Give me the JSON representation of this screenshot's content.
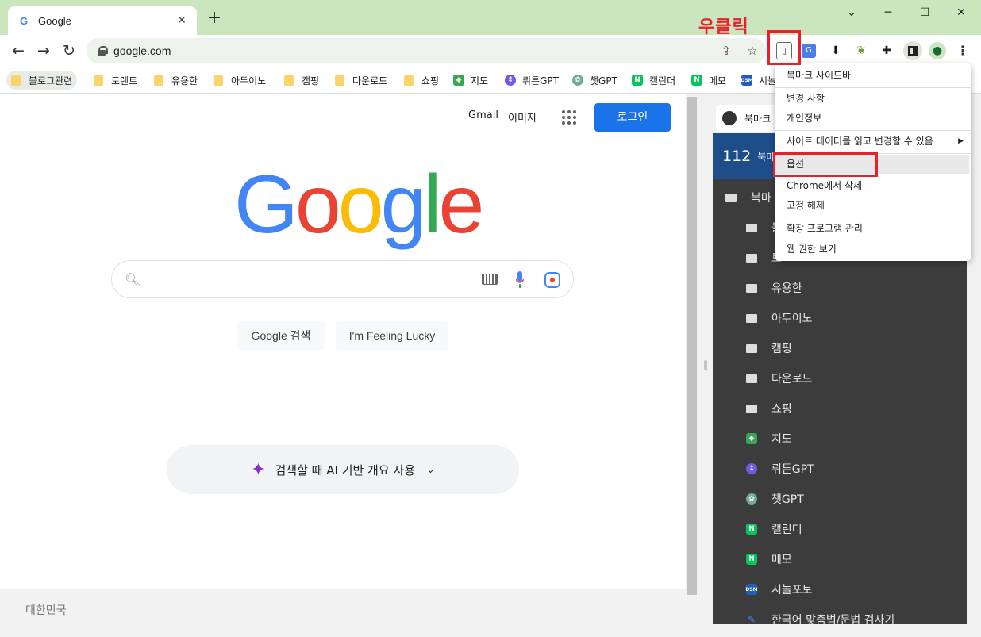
{
  "browser": {
    "tab_title": "Google",
    "tab_favicon": "G",
    "url": "google.com"
  },
  "bookmarks": [
    {
      "label": "블로그관련",
      "icon": "folder"
    },
    {
      "label": "토렌트",
      "icon": "folder"
    },
    {
      "label": "유용한",
      "icon": "folder"
    },
    {
      "label": "아두이노",
      "icon": "folder"
    },
    {
      "label": "캠핑",
      "icon": "folder"
    },
    {
      "label": "다운로드",
      "icon": "folder"
    },
    {
      "label": "쇼핑",
      "icon": "folder"
    },
    {
      "label": "지도",
      "icon": "maps-icon"
    },
    {
      "label": "뤼튼GPT",
      "icon": "wrtn-icon"
    },
    {
      "label": "챗GPT",
      "icon": "chatgpt-icon"
    },
    {
      "label": "캘린더",
      "icon": "naver-icon"
    },
    {
      "label": "메모",
      "icon": "naver-icon"
    },
    {
      "label": "시놀",
      "icon": "dsm-icon"
    }
  ],
  "google": {
    "gmail": "Gmail",
    "images": "이미지",
    "login": "로그인",
    "logo_letters": [
      "G",
      "o",
      "o",
      "g",
      "l",
      "e"
    ],
    "search_button": "Google 검색",
    "lucky_button": "I'm Feeling Lucky",
    "ai_overview": "검색할 때 AI 기반 개요 사용",
    "footer_country": "대한민국"
  },
  "side_panel": {
    "header": "북마크",
    "count": "112",
    "count_label": "북마",
    "root_folder": "북마",
    "items": [
      {
        "label": "블",
        "type": "folder"
      },
      {
        "label": "토",
        "type": "folder"
      },
      {
        "label": "유용한",
        "type": "folder"
      },
      {
        "label": "아두이노",
        "type": "folder"
      },
      {
        "label": "캠핑",
        "type": "folder"
      },
      {
        "label": "다운로드",
        "type": "folder"
      },
      {
        "label": "쇼핑",
        "type": "folder"
      },
      {
        "label": "지도",
        "type": "maps"
      },
      {
        "label": "뤼튼GPT",
        "type": "wrtn"
      },
      {
        "label": "챗GPT",
        "type": "chatgpt"
      },
      {
        "label": "캘린더",
        "type": "naver"
      },
      {
        "label": "메모",
        "type": "naver"
      },
      {
        "label": "시놀포토",
        "type": "dsm"
      },
      {
        "label": "한국어 맞춤법/문법 검사기",
        "type": "spell"
      }
    ]
  },
  "context_menu": {
    "items": [
      "북마크 사이드바",
      "변경 사항",
      "개인정보",
      "사이트 데이터를 읽고 변경할 수 있음",
      "옵션",
      "Chrome에서 삭제",
      "고정 해제",
      "확장 프로그램 관리",
      "웹 권한 보기"
    ]
  },
  "annotation": "우클릭",
  "colors": {
    "accent_red": "#e8202a",
    "google_blue": "#4285f4",
    "google_red": "#ea4335",
    "google_yellow": "#fbbc05",
    "google_green": "#34a853",
    "login_blue": "#1a73e8"
  }
}
